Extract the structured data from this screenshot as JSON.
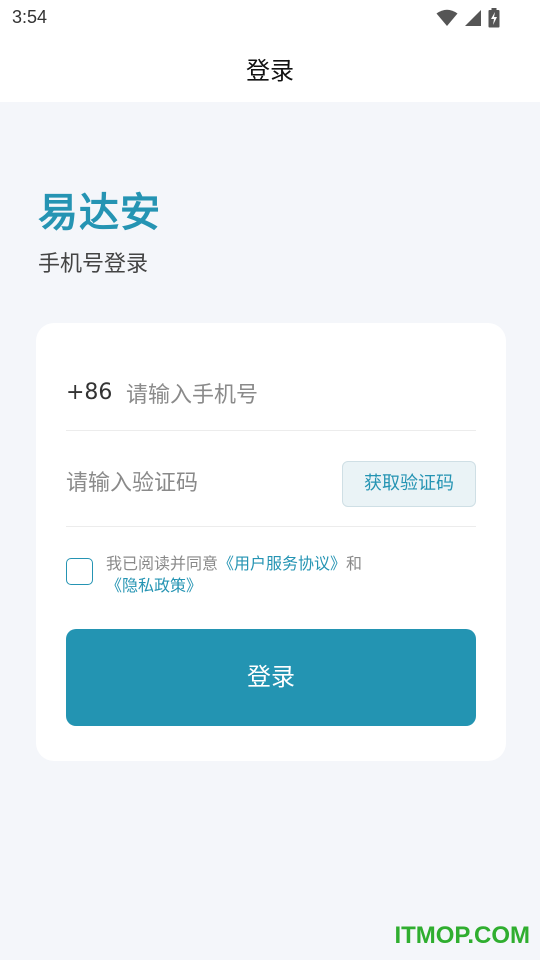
{
  "status_bar": {
    "time": "3:54",
    "icons": [
      "wifi-icon",
      "signal-icon",
      "battery-charging-icon"
    ]
  },
  "app_bar": {
    "title": "登录"
  },
  "brand": {
    "name": "易达安",
    "subtitle": "手机号登录",
    "color": "#2594b3"
  },
  "form": {
    "country_code": "+86",
    "phone_placeholder": "请输入手机号",
    "code_placeholder": "请输入验证码",
    "get_code_label": "获取验证码",
    "agreement": {
      "prefix": "我已阅读并同意",
      "terms_link": "《用户服务协议》",
      "and": "和",
      "privacy_link": "《隐私政策》",
      "checked": false
    },
    "login_label": "登录"
  },
  "watermark": "ITMOP.COM"
}
